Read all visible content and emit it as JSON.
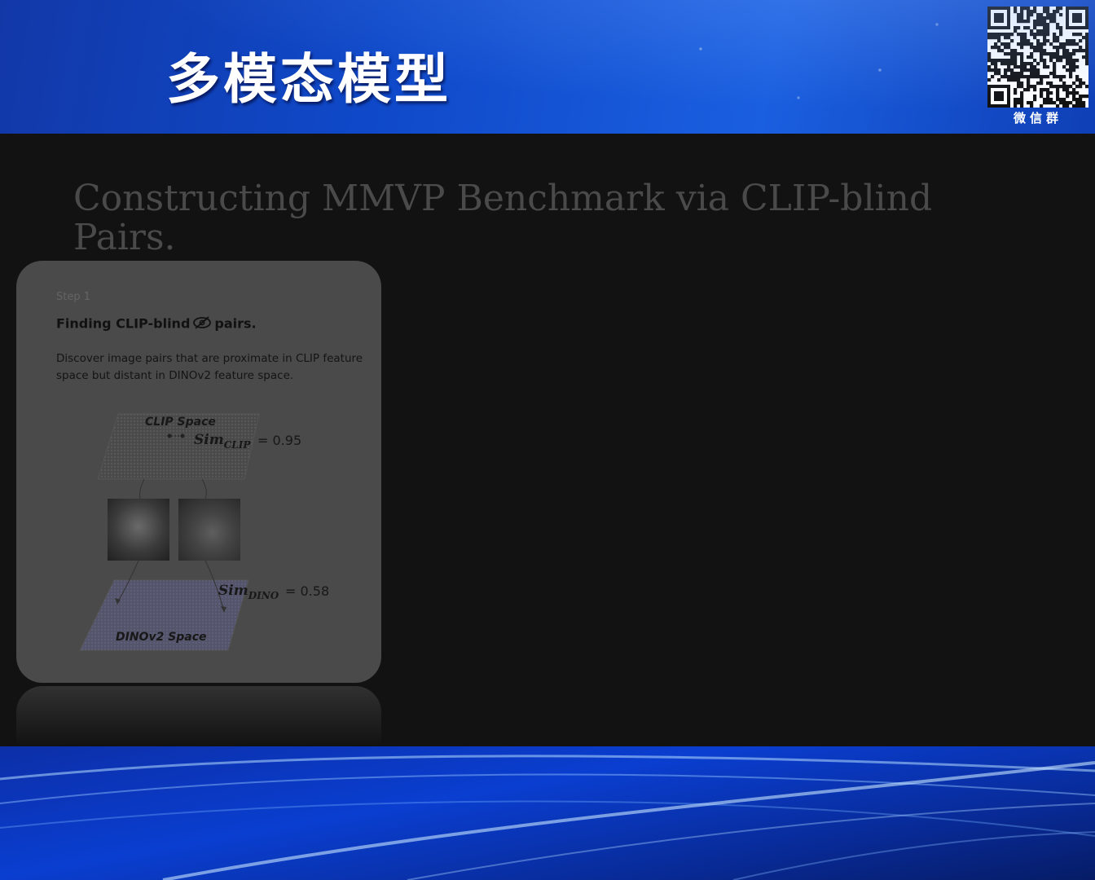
{
  "banner": {
    "title": "多模态模型",
    "qr_caption": "微信群"
  },
  "slide": {
    "heading": "Constructing MMVP Benchmark via CLIP-blind Pairs.",
    "card": {
      "step": "Step 1",
      "title_prefix": "Finding CLIP-blind",
      "title_suffix": "pairs.",
      "description": "Discover image pairs that are proximate in CLIP feature space but distant in DINOv2 feature space.",
      "clip_space_label": "CLIP Space",
      "sim_clip_label": "Sim",
      "sim_clip_sub": "CLIP",
      "sim_clip_value": "= 0.95",
      "dino_space_label": "DINOv2 Space",
      "sim_dino_label": "Sim",
      "sim_dino_sub": "DINO",
      "sim_dino_value": "= 0.58"
    }
  },
  "icons": {
    "eye_slash": "eye-slash-icon",
    "qr": "qr-code-icon"
  }
}
